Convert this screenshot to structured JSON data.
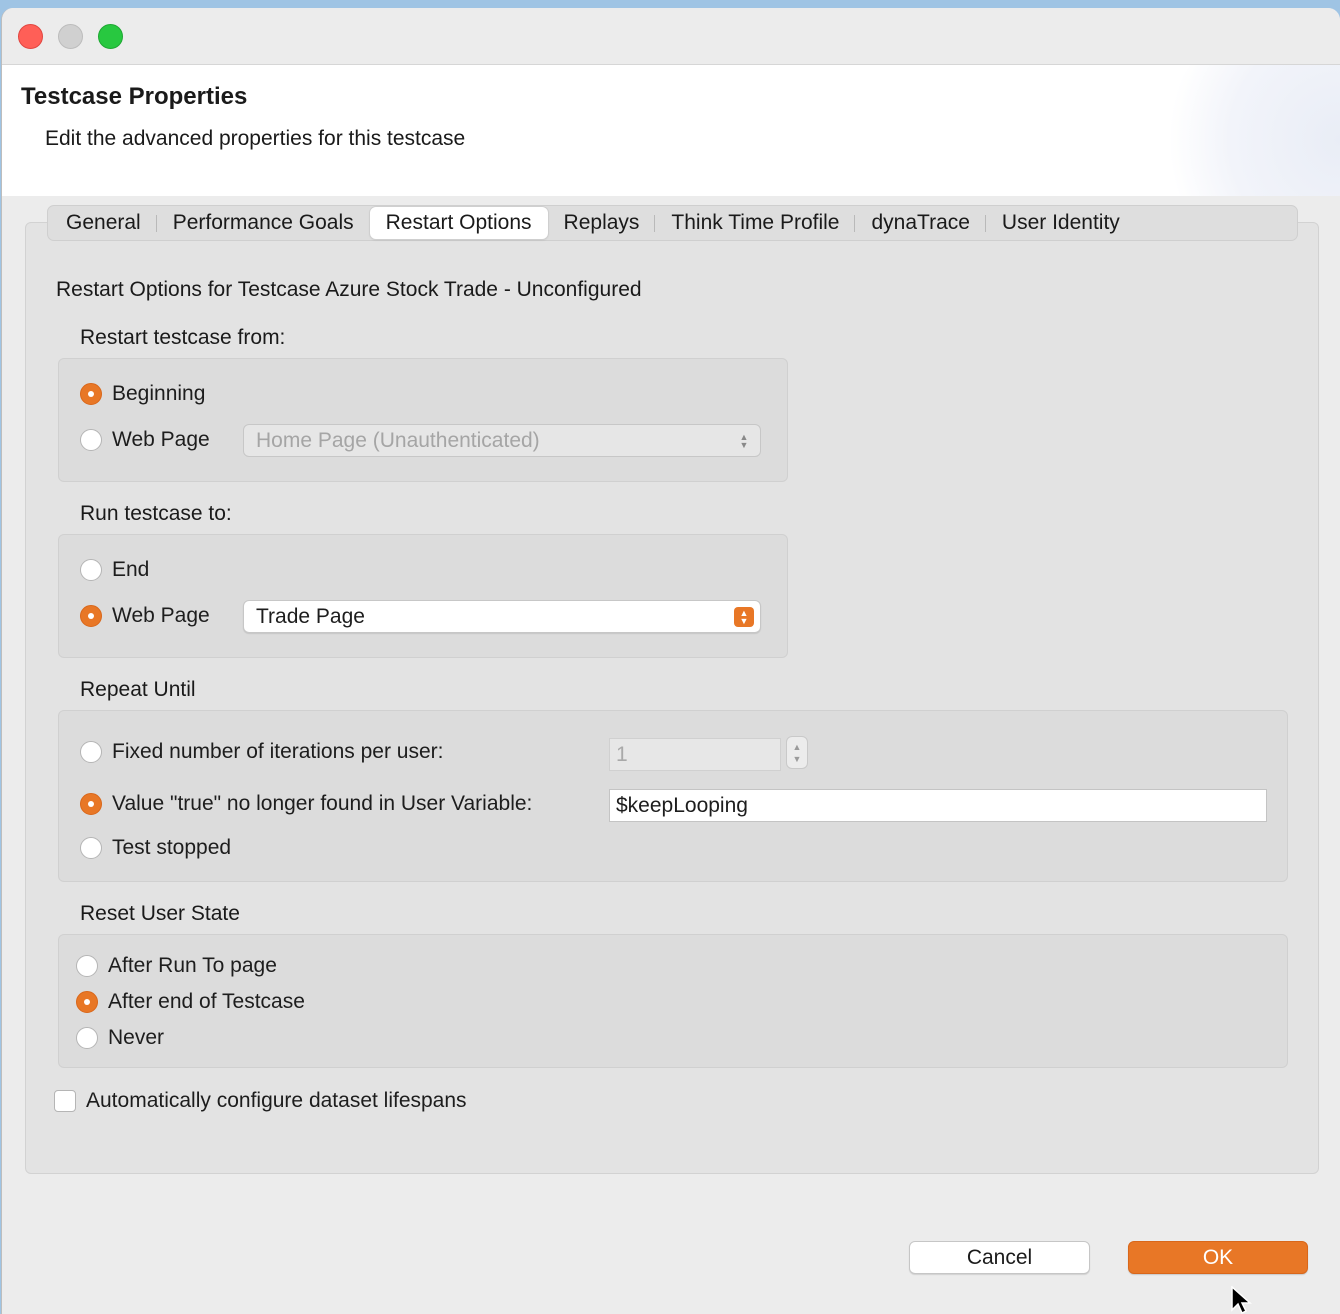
{
  "header": {
    "title": "Testcase Properties",
    "subtitle": "Edit the advanced properties for this testcase"
  },
  "tabs": [
    {
      "label": "General",
      "active": false
    },
    {
      "label": "Performance Goals",
      "active": false
    },
    {
      "label": "Restart Options",
      "active": true
    },
    {
      "label": "Replays",
      "active": false
    },
    {
      "label": "Think Time Profile",
      "active": false
    },
    {
      "label": "dynaTrace",
      "active": false
    },
    {
      "label": "User Identity",
      "active": false
    }
  ],
  "content": {
    "heading": "Restart Options for Testcase Azure Stock Trade - Unconfigured",
    "restart_from": {
      "label": "Restart testcase from:",
      "beginning_label": "Beginning",
      "web_page_label": "Web Page",
      "selected": "Beginning",
      "page_select_value": "Home Page (Unauthenticated)"
    },
    "run_to": {
      "label": "Run testcase to:",
      "end_label": "End",
      "web_page_label": "Web Page",
      "selected": "Web Page",
      "page_select_value": "Trade Page"
    },
    "repeat_until": {
      "label": "Repeat Until",
      "fixed_label": "Fixed number of iterations per user:",
      "fixed_value": "1",
      "value_label": "Value \"true\" no longer found in User Variable:",
      "value_field": "$keepLooping",
      "stopped_label": "Test stopped",
      "selected": "value"
    },
    "reset_state": {
      "label": "Reset User State",
      "after_run_to_label": "After Run To page",
      "after_end_label": "After end of Testcase",
      "never_label": "Never",
      "selected": "After end of Testcase"
    },
    "auto_configure_label": "Automatically configure dataset lifespans",
    "auto_configure_checked": false
  },
  "buttons": {
    "cancel": "Cancel",
    "ok": "OK"
  },
  "colors": {
    "accent": "#e87726",
    "window_bg": "#ececec",
    "group_bg": "#dcdcdc"
  }
}
